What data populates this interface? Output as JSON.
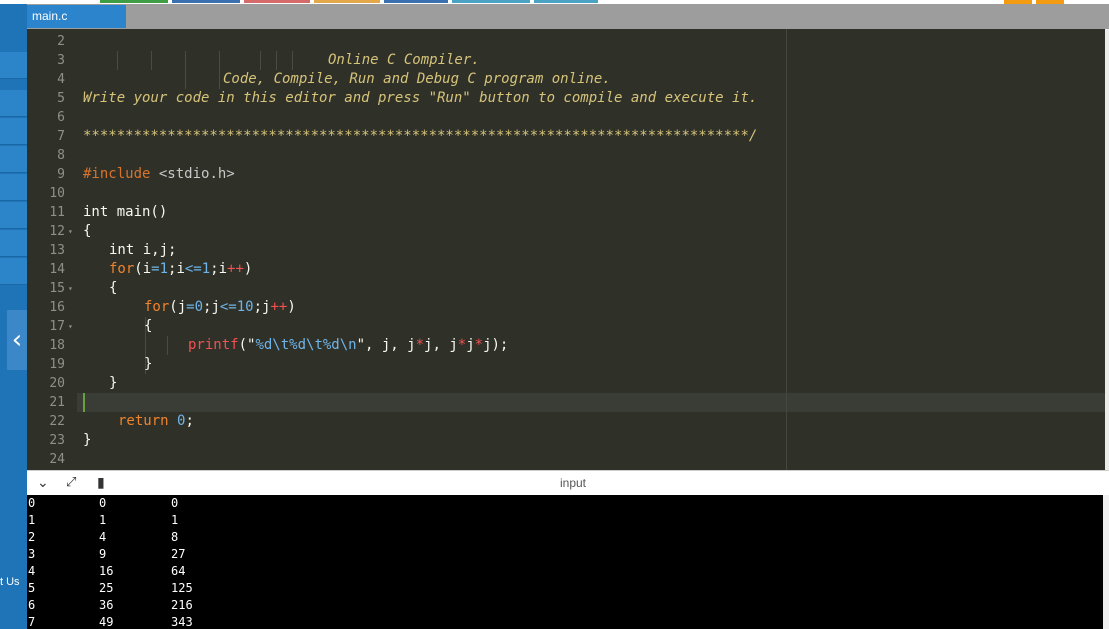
{
  "tab": {
    "filename": "main.c"
  },
  "sidebar": {
    "contact_label": "t Us",
    "collapse_icon": "chevron-left-icon"
  },
  "colors": {
    "accent": "#2b84cc",
    "editor_bg": "#2f3129",
    "console_bg": "#000000"
  },
  "editor": {
    "line_numbers": [
      "2",
      "3",
      "4",
      "5",
      "6",
      "7",
      "8",
      "9",
      "10",
      "11",
      "12",
      "13",
      "14",
      "15",
      "16",
      "17",
      "18",
      "19",
      "20",
      "21",
      "22",
      "23",
      "24"
    ],
    "lines": {
      "l3": "Online C Compiler.",
      "l4": "Code, Compile, Run and Debug C program online.",
      "l5": "Write your code in this editor and press \"Run\" button to compile and execute it.",
      "l7": "*******************************************************************************/",
      "l9_directive": "#include",
      "l9_header": "<stdio.h>",
      "l11": "int main()",
      "l12": "{",
      "l13": "int i,j;",
      "l14_for": "for",
      "l14_a": "(i",
      "l14_b": "=1",
      "l14_c": ";i",
      "l14_d": "<=1",
      "l14_e": ";i",
      "l14_f": "++",
      "l14_g": ")",
      "l15": "{",
      "l16_for": "for",
      "l16_a": "(j",
      "l16_b": "=0",
      "l16_c": ";j",
      "l16_d": "<=10",
      "l16_e": ";j",
      "l16_f": "++",
      "l16_g": ")",
      "l17": "{",
      "l18_fn": "printf",
      "l18_a": "(\"",
      "l18_fmt": "%d\\t%d\\t%d\\n",
      "l18_b": "\", j, j",
      "l18_op1": "*",
      "l18_c": "j, j",
      "l18_op2": "*",
      "l18_d": "j",
      "l18_op3": "*",
      "l18_e": "j);",
      "l19": "}",
      "l20": "}",
      "l22_kw": "return",
      "l22_num": "0",
      "l22_end": ";",
      "l23": "}"
    }
  },
  "io_bar": {
    "input_label": "input"
  },
  "output": {
    "rows": [
      [
        "0",
        "0",
        "0"
      ],
      [
        "1",
        "1",
        "1"
      ],
      [
        "2",
        "4",
        "8"
      ],
      [
        "3",
        "9",
        "27"
      ],
      [
        "4",
        "16",
        "64"
      ],
      [
        "5",
        "25",
        "125"
      ],
      [
        "6",
        "36",
        "216"
      ],
      [
        "7",
        "49",
        "343"
      ]
    ]
  }
}
